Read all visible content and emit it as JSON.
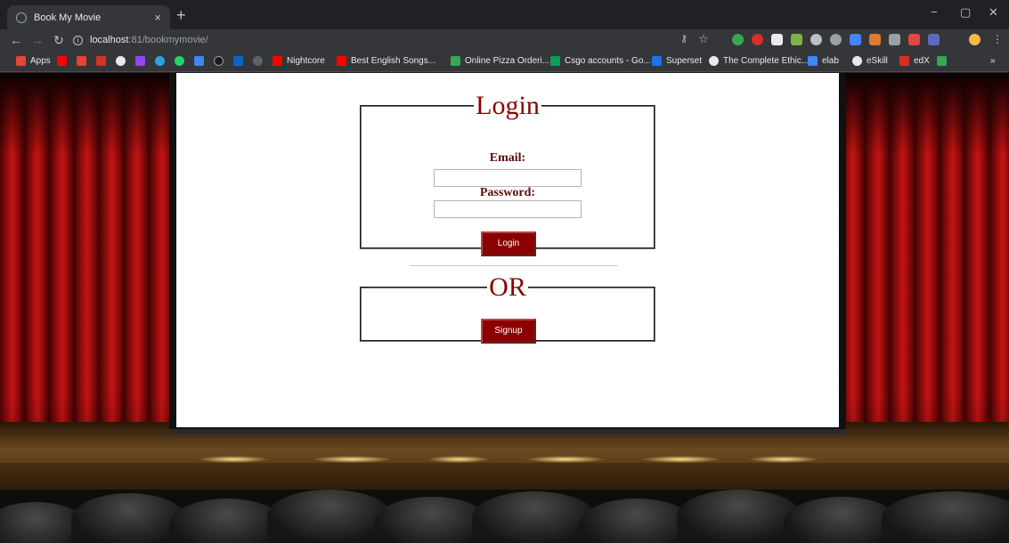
{
  "browser": {
    "tab_title": "Book My Movie",
    "tab_close": "×",
    "new_tab": "+",
    "window_controls": {
      "minimize": "−",
      "maximize": "▢",
      "close": "✕"
    },
    "url_host": "localhost",
    "url_rest": ":81/bookmymovie/"
  },
  "bookmarks": [
    {
      "label": "Apps",
      "color": "#ea4335"
    },
    {
      "label": "Nightcore",
      "color": "#ff0000"
    },
    {
      "label": "Best English Songs...",
      "color": "#ff0000"
    },
    {
      "label": "Online Pizza Orderi...",
      "color": "#34a853"
    },
    {
      "label": "Csgo accounts - Go...",
      "color": "#0f9d58"
    },
    {
      "label": "Superset",
      "color": "#1a73e8"
    },
    {
      "label": "The Complete Ethic...",
      "color": "#e8eaed"
    },
    {
      "label": "elab",
      "color": "#4285f4"
    },
    {
      "label": "eSkill",
      "color": "#e8eaed"
    },
    {
      "label": "edX",
      "color": "#d93025"
    }
  ],
  "bookmarks_overflow": "»",
  "page": {
    "login": {
      "legend": "Login",
      "email_label": "Email:",
      "password_label": "Password:",
      "email_value": "",
      "password_value": "",
      "button": "Login"
    },
    "or": {
      "legend": "OR",
      "button": "Signup"
    }
  },
  "colors": {
    "accent": "#8b0000",
    "label": "#5a0a0a",
    "curtain": "#c41414"
  }
}
